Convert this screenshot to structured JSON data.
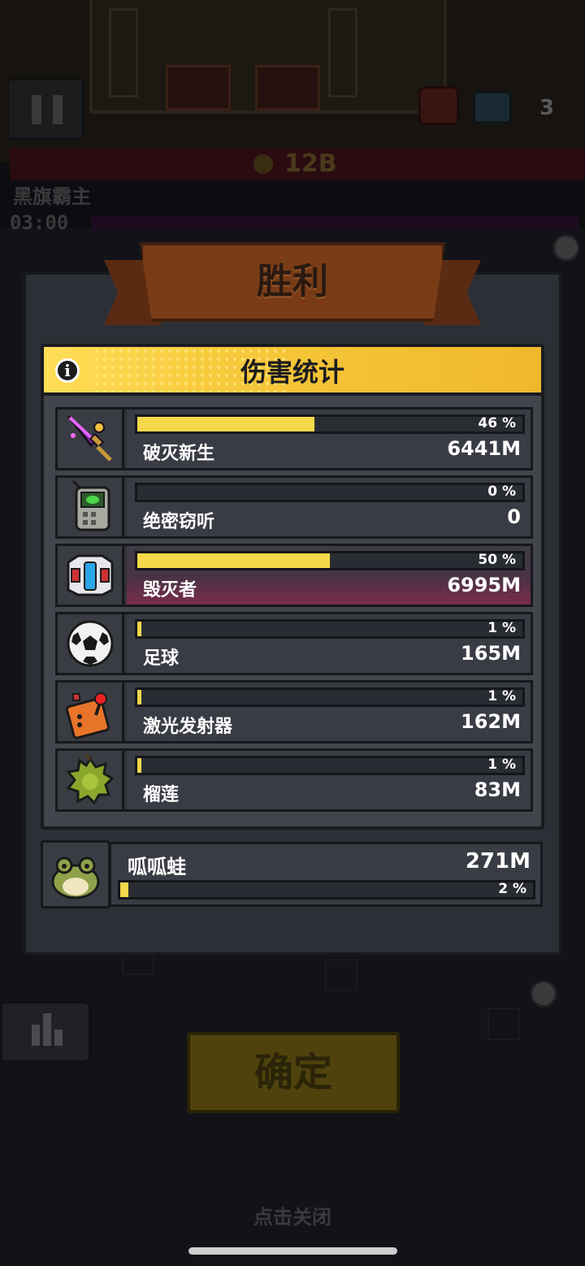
{
  "hud": {
    "gold": "12B",
    "boss_name": "黑旗霸主",
    "timer": "03:00",
    "chest_count": "3"
  },
  "modal": {
    "result_title": "胜利",
    "stats_title": "伤害统计",
    "info_glyph": "i"
  },
  "weapons": [
    {
      "name": "破灭新生",
      "damage": "6441M",
      "percent_label": "46 %",
      "percent": 46,
      "icon": "purple-sword-icon"
    },
    {
      "name": "绝密窃听",
      "damage": "0",
      "percent_label": "0 %",
      "percent": 0,
      "icon": "spy-device-icon"
    },
    {
      "name": "毁灭者",
      "damage": "6995M",
      "percent_label": "50 %",
      "percent": 50,
      "icon": "robot-helmet-icon"
    },
    {
      "name": "足球",
      "damage": "165M",
      "percent_label": "1 %",
      "percent": 1,
      "icon": "soccer-ball-icon"
    },
    {
      "name": "激光发射器",
      "damage": "162M",
      "percent_label": "1 %",
      "percent": 1,
      "icon": "laser-controller-icon"
    },
    {
      "name": "榴莲",
      "damage": "83M",
      "percent_label": "1 %",
      "percent": 1,
      "icon": "durian-icon"
    }
  ],
  "pet": {
    "name": "呱呱蛙",
    "damage": "271M",
    "percent_label": "2 %",
    "percent": 2,
    "icon": "frog-icon"
  },
  "buttons": {
    "confirm": "确定",
    "tap_close": "点击关闭"
  },
  "colors": {
    "bar_fill": "#f6d84a",
    "header_yellow": "#f6c73a",
    "highlight_row": "#7a2c4c"
  }
}
